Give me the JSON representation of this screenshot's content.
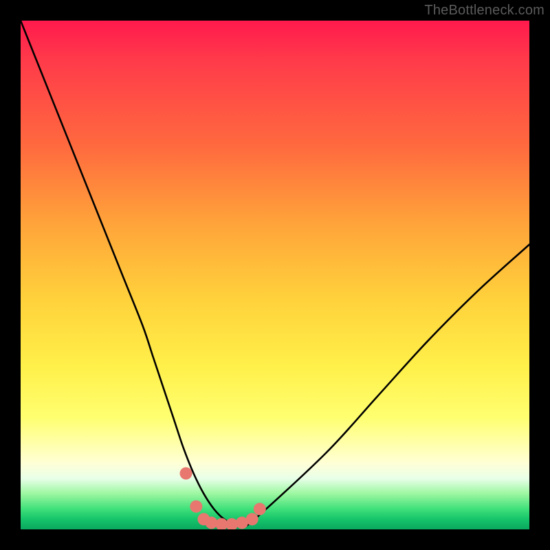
{
  "watermark": "TheBottleneck.com",
  "chart_data": {
    "type": "line",
    "title": "",
    "xlabel": "",
    "ylabel": "",
    "xlim": [
      0,
      100
    ],
    "ylim": [
      0,
      100
    ],
    "grid": false,
    "series": [
      {
        "name": "bottleneck-curve",
        "color": "#000000",
        "x": [
          0,
          4,
          8,
          12,
          16,
          20,
          24,
          26,
          28,
          30,
          32,
          34,
          36,
          38,
          40,
          42,
          44,
          46,
          60,
          70,
          80,
          90,
          100
        ],
        "y": [
          100,
          90,
          80,
          70,
          60,
          50,
          40,
          34,
          28,
          22,
          16,
          11,
          7,
          4,
          2,
          1,
          1,
          2,
          15,
          26,
          37,
          47,
          56
        ]
      },
      {
        "name": "bottom-dots",
        "color": "#e8776f",
        "type": "scatter",
        "x": [
          32.5,
          34.5,
          36.0,
          37.5,
          39.5,
          41.5,
          43.5,
          45.5,
          47.0
        ],
        "y": [
          11.0,
          4.5,
          2.0,
          1.3,
          1.0,
          1.0,
          1.3,
          2.0,
          4.0
        ]
      }
    ],
    "gradient_stops": [
      {
        "pos": 0.0,
        "color": "#ff1a4d"
      },
      {
        "pos": 0.25,
        "color": "#ff6b3e"
      },
      {
        "pos": 0.55,
        "color": "#ffd23b"
      },
      {
        "pos": 0.78,
        "color": "#ffff70"
      },
      {
        "pos": 0.9,
        "color": "#e8ffe8"
      },
      {
        "pos": 1.0,
        "color": "#0aa85f"
      }
    ]
  }
}
